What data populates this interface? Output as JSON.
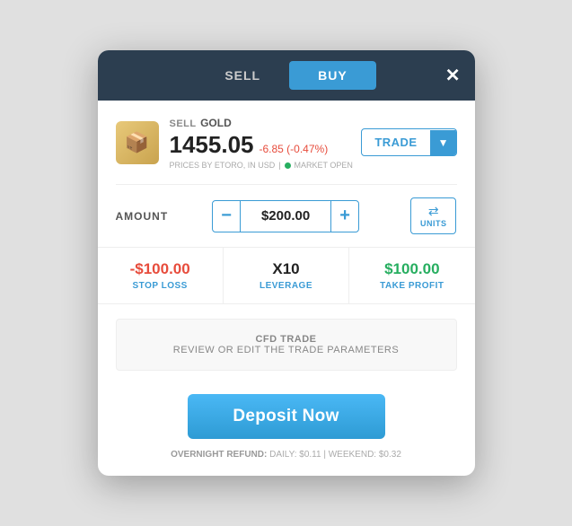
{
  "modal": {
    "tabs": [
      {
        "id": "sell",
        "label": "SELL",
        "active": false
      },
      {
        "id": "buy",
        "label": "BUY",
        "active": true
      }
    ],
    "close_label": "✕",
    "asset": {
      "icon": "📦",
      "sell_label": "SELL",
      "name": "GOLD",
      "price": "1455.05",
      "change": "-6.85 (-0.47%)",
      "price_source": "PRICES BY ETORO, IN USD",
      "market_status": "MARKET OPEN"
    },
    "trade_button": {
      "label": "TRADE",
      "arrow": "▼"
    },
    "amount": {
      "label": "AMOUNT",
      "minus": "−",
      "value": "$200.00",
      "plus": "+",
      "units_label": "UNITS"
    },
    "params": [
      {
        "id": "stop-loss",
        "value": "-$100.00",
        "label": "STOP LOSS",
        "color": "red"
      },
      {
        "id": "leverage",
        "value": "X10",
        "label": "LEVERAGE",
        "color": "normal"
      },
      {
        "id": "take-profit",
        "value": "$100.00",
        "label": "TAKE PROFIT",
        "color": "green"
      }
    ],
    "cfd": {
      "title": "CFD TRADE",
      "subtitle": "REVIEW OR EDIT THE TRADE PARAMETERS"
    },
    "deposit_btn": "Deposit Now",
    "overnight": {
      "label": "OVERNIGHT REFUND:",
      "daily": "DAILY: $0.11",
      "weekend": "WEEKEND: $0.32"
    }
  }
}
